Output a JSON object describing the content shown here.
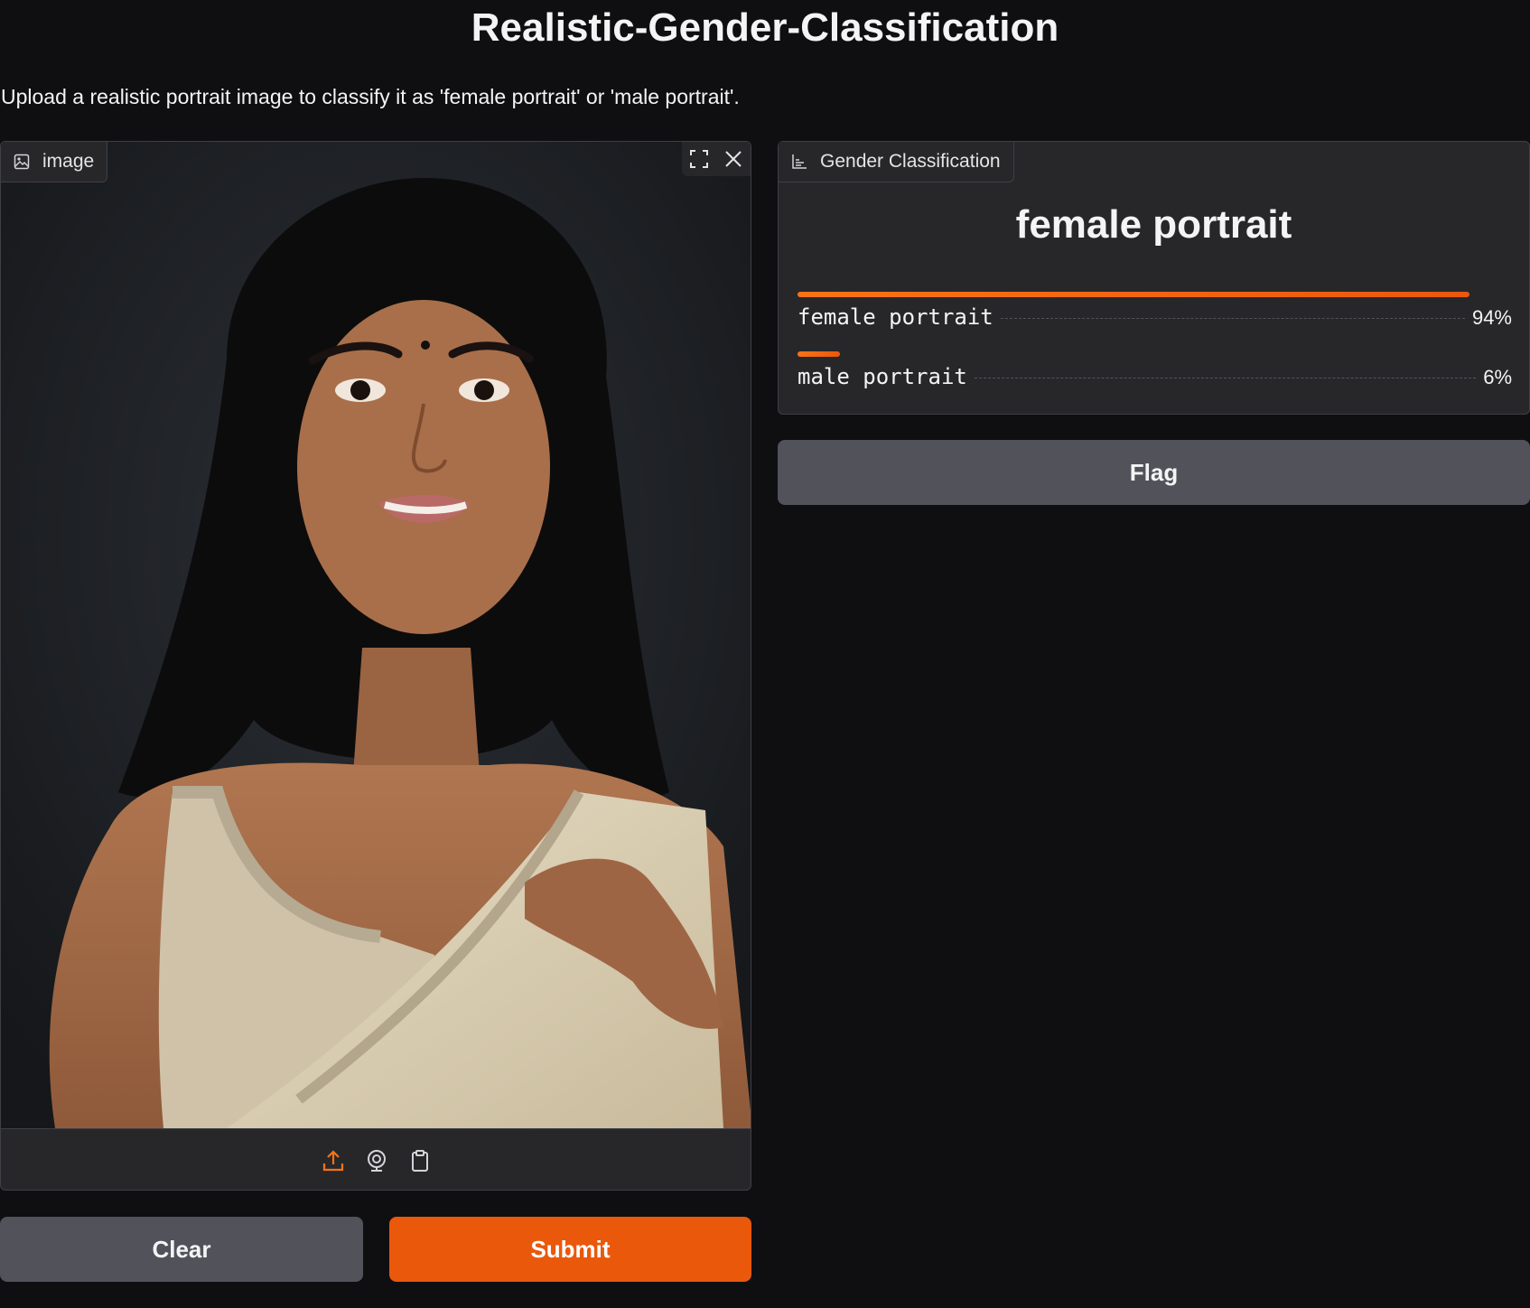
{
  "app": {
    "title": "Realistic-Gender-Classification",
    "description": "Upload a realistic portrait image to classify it as 'female portrait' or 'male portrait'."
  },
  "input": {
    "label": "image",
    "label_icon": "image-icon",
    "controls": [
      "fullscreen-icon",
      "close-icon"
    ],
    "sources": [
      "upload-icon",
      "webcam-icon",
      "clipboard-icon"
    ]
  },
  "output": {
    "label": "Gender Classification",
    "label_icon": "bar-chart-icon",
    "prediction": "female portrait",
    "confidences": [
      {
        "label": "female portrait",
        "value_text": "94%",
        "value": 0.94
      },
      {
        "label": "male portrait",
        "value_text": "6%",
        "value": 0.06
      }
    ]
  },
  "buttons": {
    "clear": "Clear",
    "submit": "Submit",
    "flag": "Flag"
  },
  "colors": {
    "background": "#0f0f11",
    "panel": "#27272a",
    "accent": "#ea580c",
    "secondary_button": "#52525b"
  }
}
